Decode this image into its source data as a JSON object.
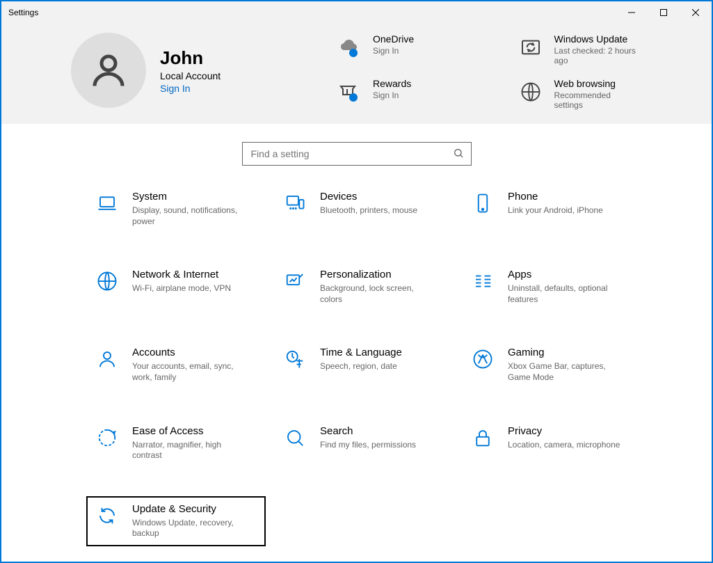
{
  "window": {
    "title": "Settings"
  },
  "account": {
    "name": "John",
    "type": "Local Account",
    "action": "Sign In"
  },
  "headerTiles": [
    {
      "title": "OneDrive",
      "sub": "Sign In"
    },
    {
      "title": "Windows Update",
      "sub": "Last checked: 2 hours ago"
    },
    {
      "title": "Rewards",
      "sub": "Sign In"
    },
    {
      "title": "Web browsing",
      "sub": "Recommended settings"
    }
  ],
  "search": {
    "placeholder": "Find a setting"
  },
  "categories": [
    {
      "title": "System",
      "sub": "Display, sound, notifications, power"
    },
    {
      "title": "Devices",
      "sub": "Bluetooth, printers, mouse"
    },
    {
      "title": "Phone",
      "sub": "Link your Android, iPhone"
    },
    {
      "title": "Network & Internet",
      "sub": "Wi-Fi, airplane mode, VPN"
    },
    {
      "title": "Personalization",
      "sub": "Background, lock screen, colors"
    },
    {
      "title": "Apps",
      "sub": "Uninstall, defaults, optional features"
    },
    {
      "title": "Accounts",
      "sub": "Your accounts, email, sync, work, family"
    },
    {
      "title": "Time & Language",
      "sub": "Speech, region, date"
    },
    {
      "title": "Gaming",
      "sub": "Xbox Game Bar, captures, Game Mode"
    },
    {
      "title": "Ease of Access",
      "sub": "Narrator, magnifier, high contrast"
    },
    {
      "title": "Search",
      "sub": "Find my files, permissions"
    },
    {
      "title": "Privacy",
      "sub": "Location, camera, microphone"
    },
    {
      "title": "Update & Security",
      "sub": "Windows Update, recovery, backup"
    }
  ]
}
